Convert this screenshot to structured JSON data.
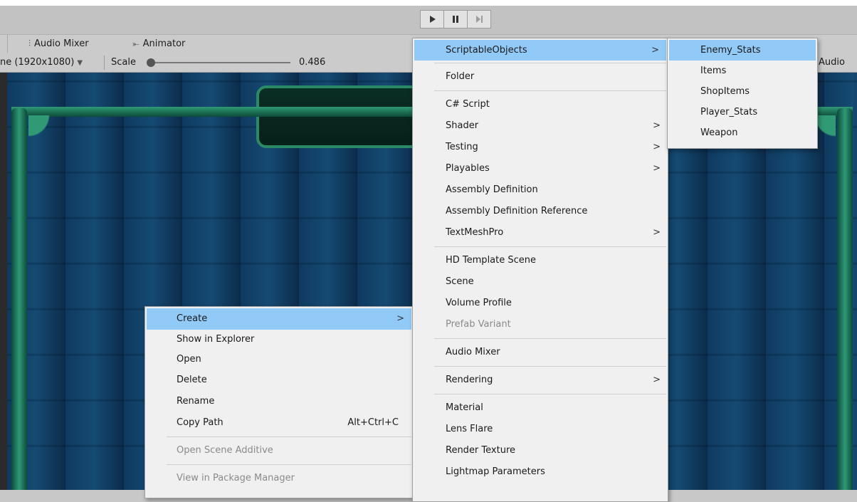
{
  "toolbar": {
    "play_icon": "play-icon",
    "pause_icon": "pause-icon",
    "step_icon": "step-icon"
  },
  "tabs": [
    {
      "label": "Audio Mixer",
      "icon": "audio-mixer-icon"
    },
    {
      "label": "Animator",
      "icon": "animator-icon"
    }
  ],
  "game_toolbar": {
    "resolution": "ne (1920x1080)",
    "scale_label": "Scale",
    "scale_value": "0.486",
    "scale_fraction": 0.0,
    "right_label": "Audio"
  },
  "context_menu": {
    "items": [
      {
        "label": "Create",
        "has_submenu": true,
        "highlighted": true
      },
      {
        "label": "Show in Explorer"
      },
      {
        "label": "Open"
      },
      {
        "label": "Delete"
      },
      {
        "label": "Rename"
      },
      {
        "label": "Copy Path",
        "shortcut": "Alt+Ctrl+C"
      },
      {
        "label": "Open Scene Additive",
        "disabled": true
      },
      {
        "label": "View in Package Manager",
        "disabled": true
      }
    ]
  },
  "create_menu": {
    "items": [
      {
        "label": "ScriptableObjects",
        "has_submenu": true,
        "highlighted": true
      },
      {
        "label": "Folder"
      },
      {
        "label": "C# Script"
      },
      {
        "label": "Shader",
        "has_submenu": true
      },
      {
        "label": "Testing",
        "has_submenu": true
      },
      {
        "label": "Playables",
        "has_submenu": true
      },
      {
        "label": "Assembly Definition"
      },
      {
        "label": "Assembly Definition Reference"
      },
      {
        "label": "TextMeshPro",
        "has_submenu": true
      },
      {
        "label": "HD Template Scene"
      },
      {
        "label": "Scene"
      },
      {
        "label": "Volume Profile"
      },
      {
        "label": "Prefab Variant",
        "disabled": true
      },
      {
        "label": "Audio Mixer"
      },
      {
        "label": "Rendering",
        "has_submenu": true
      },
      {
        "label": "Material"
      },
      {
        "label": "Lens Flare"
      },
      {
        "label": "Render Texture"
      },
      {
        "label": "Lightmap Parameters"
      }
    ]
  },
  "scriptable_objects_menu": {
    "items": [
      {
        "label": "Enemy_Stats",
        "highlighted": true
      },
      {
        "label": "Items"
      },
      {
        "label": "ShopItems"
      },
      {
        "label": "Player_Stats"
      },
      {
        "label": "Weapon"
      }
    ]
  },
  "submenu_arrow": ">",
  "colors": {
    "highlight": "#91c9f7",
    "menu_bg": "#f0f0f0",
    "toolbar_bg": "#c2c2c2"
  }
}
